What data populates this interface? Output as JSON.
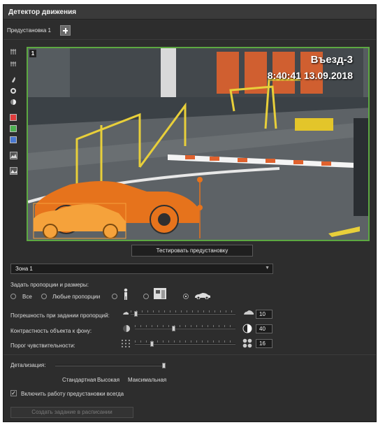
{
  "window": {
    "title": "Детектор движения"
  },
  "preset": {
    "label": "Предустановка 1"
  },
  "toolbar": {
    "tools": [
      "grid-icon",
      "grid-small-icon",
      "brush-icon",
      "circle-icon",
      "contrast-icon"
    ],
    "colors": [
      "#e03c3c",
      "#4caf50",
      "#4a78d0"
    ],
    "bottom_tools": [
      "mask-icon",
      "image-icon"
    ]
  },
  "video": {
    "badge": "1",
    "camera_name": "Въезд-3",
    "timestamp": "8:40:41  13.09.2018",
    "border_color": "#5da842",
    "zone_color": "#e6731c"
  },
  "test_button": {
    "label": "Тестировать предустановку"
  },
  "zone_select": {
    "value": "Зона 1"
  },
  "proportions": {
    "label": "Задать пропорции и размеры:",
    "options": [
      {
        "label": "Все",
        "selected": false
      },
      {
        "label": "Любые пропорции",
        "selected": false
      },
      {
        "label": "",
        "icon": "person-icon",
        "selected": false
      },
      {
        "label": "",
        "icon": "cargo-icon",
        "selected": false
      },
      {
        "label": "",
        "icon": "car-icon",
        "selected": true
      }
    ]
  },
  "sliders": [
    {
      "label": "Погрешность при задании пропорций:",
      "value": "10",
      "position": 0.05,
      "left_icon": "car-small-icon",
      "right_icon": "car-large-icon"
    },
    {
      "label": "Контрастность объекта к фону:",
      "value": "40",
      "position": 0.4,
      "left_icon": "contrast-low-icon",
      "right_icon": "contrast-high-icon"
    },
    {
      "label": "Порог чувствительности:",
      "value": "16",
      "position": 0.16,
      "left_icon": "dots-small-icon",
      "right_icon": "dots-large-icon"
    }
  ],
  "detail": {
    "label": "Детализация:",
    "position": 1.0,
    "levels": [
      "Стандартная",
      "Высокая",
      "Максимальная"
    ]
  },
  "always_on": {
    "label": "Включить работу предустановки всегда",
    "checked": true
  },
  "schedule_button": {
    "label": "Создать задание в расписании"
  }
}
